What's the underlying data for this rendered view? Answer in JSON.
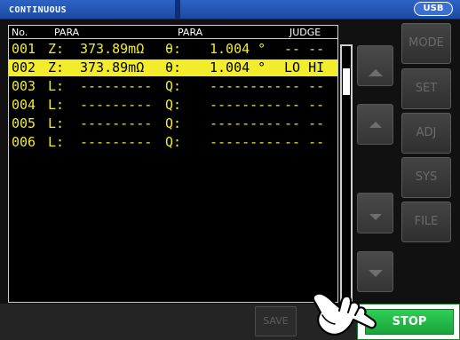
{
  "title": "CONTINUOUS",
  "usb_label": "USB",
  "headers": {
    "no": "No.",
    "para1": "PARA",
    "para2": "PARA",
    "judge": "JUDGE"
  },
  "rows": [
    {
      "no": "001",
      "p1_label": "Z:",
      "p1_value": "373.89mΩ",
      "p2_label": "θ:",
      "p2_value": "1.004 °",
      "judge": "-- --",
      "selected": false
    },
    {
      "no": "002",
      "p1_label": "Z:",
      "p1_value": "373.89mΩ",
      "p2_label": "θ:",
      "p2_value": "1.004 °",
      "judge": "LO HI",
      "selected": true
    },
    {
      "no": "003",
      "p1_label": "L:",
      "p1_value": "---------",
      "p2_label": "Q:",
      "p2_value": "---------",
      "judge": "-- --",
      "selected": false
    },
    {
      "no": "004",
      "p1_label": "L:",
      "p1_value": "---------",
      "p2_label": "Q:",
      "p2_value": "---------",
      "judge": "-- --",
      "selected": false
    },
    {
      "no": "005",
      "p1_label": "L:",
      "p1_value": "---------",
      "p2_label": "Q:",
      "p2_value": "---------",
      "judge": "-- --",
      "selected": false
    },
    {
      "no": "006",
      "p1_label": "L:",
      "p1_value": "---------",
      "p2_label": "Q:",
      "p2_value": "---------",
      "judge": "-- --",
      "selected": false
    }
  ],
  "side_menu": [
    "MODE",
    "SET",
    "ADJ",
    "SYS",
    "FILE"
  ],
  "save_label": "SAVE",
  "stop_label": "STOP",
  "icons": {
    "pointer": "pointing-hand-icon",
    "up": "triangle-up-icon",
    "down": "triangle-down-icon"
  },
  "colors": {
    "row_text": "#f2ec2a",
    "selected_bg": "#f2ec2a",
    "stop_green": "#22b944",
    "title_blue": "#2359c0"
  }
}
